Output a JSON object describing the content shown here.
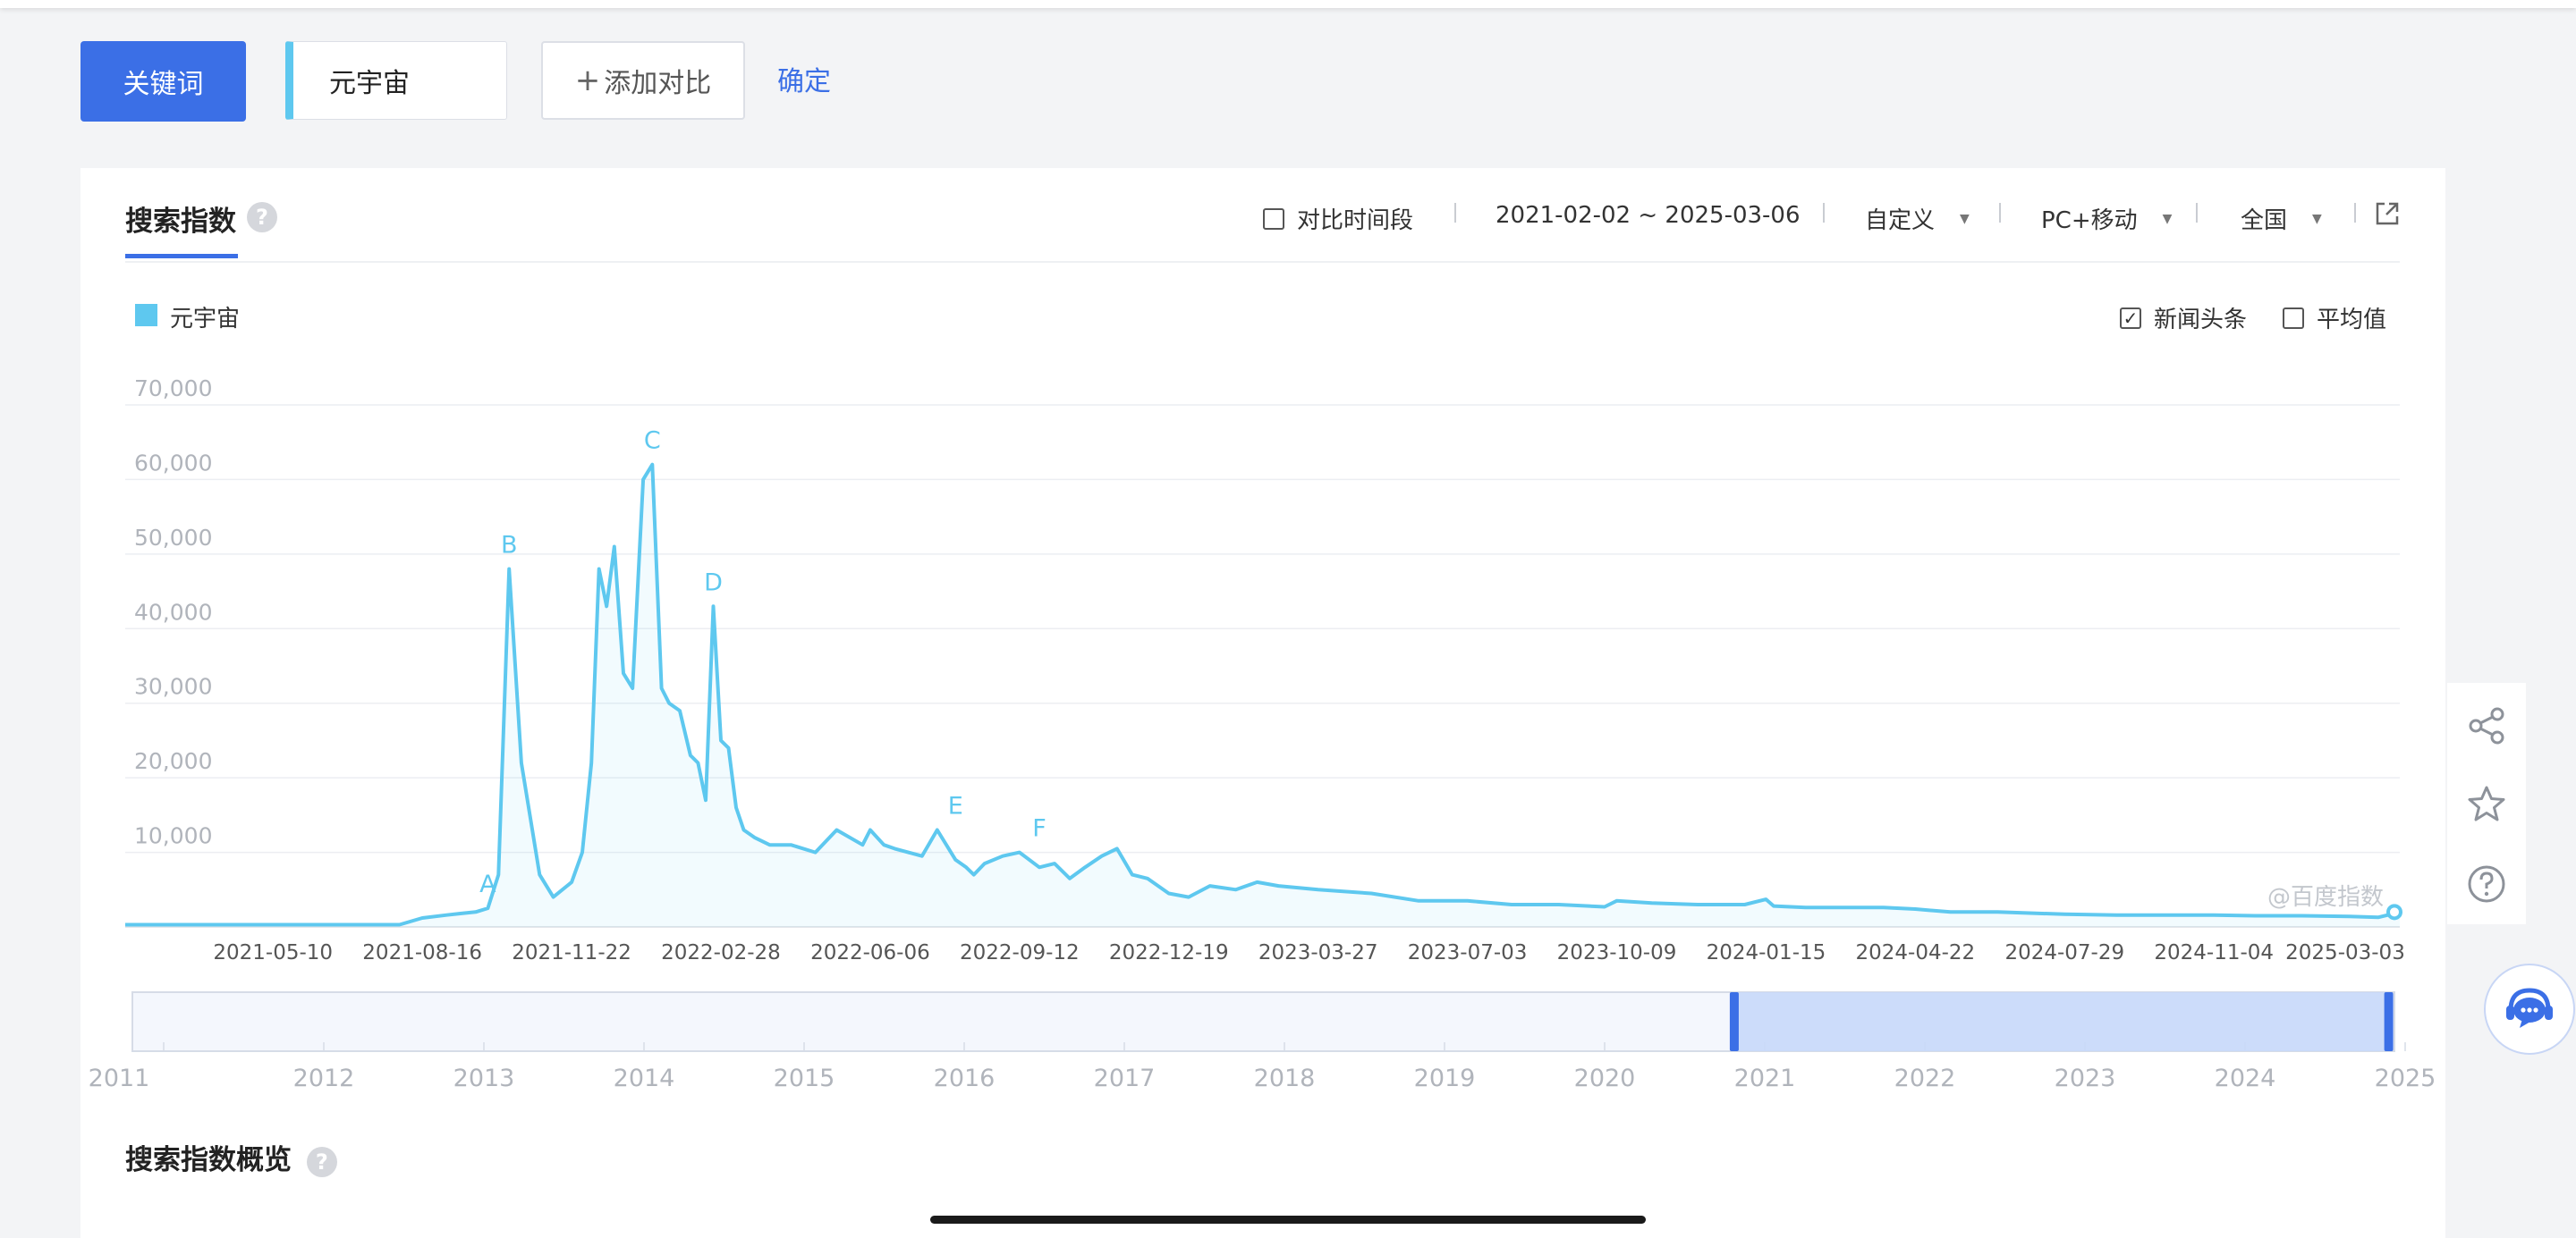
{
  "toolbar": {
    "keyword_button": "关键词",
    "keyword_value": "元宇宙",
    "add_compare": "添加对比",
    "confirm": "确定"
  },
  "card": {
    "tab_title": "搜索指数",
    "help_glyph": "?",
    "compare_period": "对比时间段",
    "date_range": "2021-02-02 ~ 2025-03-06",
    "custom": "自定义",
    "device": "PC+移动",
    "region": "全国",
    "legend": "元宇宙",
    "news_headlines": {
      "label": "新闻头条",
      "checked": true
    },
    "average": {
      "label": "平均值",
      "checked": false
    },
    "watermark": "@百度指数"
  },
  "overview": {
    "title": "搜索指数概览"
  },
  "colors": {
    "accent": "#3b6fe6",
    "series": "#5ec8ef",
    "brush": "#c8d8fa"
  },
  "icons": {
    "external": "external-link-icon",
    "share": "share-icon",
    "star": "star-icon",
    "help": "question-circle-icon",
    "chat": "customer-service-icon"
  },
  "chart_data": {
    "type": "area",
    "series": [
      {
        "name": "元宇宙",
        "x": [
          "2021-02-02",
          "2021-03-15",
          "2021-05-10",
          "2021-06-20",
          "2021-07-20",
          "2021-08-01",
          "2021-08-16",
          "2021-09-01",
          "2021-09-10",
          "2021-09-20",
          "2021-09-28",
          "2021-10-05",
          "2021-10-12",
          "2021-10-20",
          "2021-11-01",
          "2021-11-10",
          "2021-11-22",
          "2021-11-29",
          "2021-12-05",
          "2021-12-10",
          "2021-12-15",
          "2021-12-20",
          "2021-12-26",
          "2022-01-01",
          "2022-01-08",
          "2022-01-14",
          "2022-01-20",
          "2022-01-25",
          "2022-02-01",
          "2022-02-08",
          "2022-02-13",
          "2022-02-18",
          "2022-02-23",
          "2022-02-28",
          "2022-03-05",
          "2022-03-10",
          "2022-03-15",
          "2022-03-22",
          "2022-04-01",
          "2022-04-15",
          "2022-05-01",
          "2022-05-15",
          "2022-06-01",
          "2022-06-06",
          "2022-06-15",
          "2022-06-22",
          "2022-07-01",
          "2022-07-10",
          "2022-07-20",
          "2022-08-01",
          "2022-08-08",
          "2022-08-13",
          "2022-08-20",
          "2022-09-01",
          "2022-09-12",
          "2022-09-25",
          "2022-10-05",
          "2022-10-15",
          "2022-10-25",
          "2022-11-05",
          "2022-11-15",
          "2022-11-25",
          "2022-12-05",
          "2022-12-19",
          "2023-01-01",
          "2023-01-15",
          "2023-02-01",
          "2023-02-15",
          "2023-03-01",
          "2023-03-27",
          "2023-05-01",
          "2023-06-01",
          "2023-06-20",
          "2023-07-03",
          "2023-08-01",
          "2023-09-01",
          "2023-10-01",
          "2023-10-09",
          "2023-11-01",
          "2023-12-01",
          "2024-01-01",
          "2024-01-15",
          "2024-01-20",
          "2024-02-10",
          "2024-03-01",
          "2024-04-01",
          "2024-04-22",
          "2024-05-15",
          "2024-06-15",
          "2024-07-29",
          "2024-09-01",
          "2024-10-01",
          "2024-11-04",
          "2024-12-01",
          "2025-01-01",
          "2025-02-01",
          "2025-02-20",
          "2025-03-06"
        ],
        "values": [
          300,
          300,
          300,
          300,
          300,
          300,
          1200,
          1600,
          1800,
          2000,
          2500,
          7000,
          48000,
          22000,
          7000,
          4000,
          6000,
          10000,
          22000,
          48000,
          43000,
          51000,
          34000,
          32000,
          60000,
          62000,
          32000,
          30000,
          29000,
          23000,
          22000,
          17000,
          43000,
          25000,
          24000,
          16000,
          13000,
          12000,
          11000,
          11000,
          10000,
          13000,
          11000,
          13000,
          11000,
          10500,
          10000,
          9500,
          13000,
          9000,
          8000,
          7000,
          8500,
          9500,
          10000,
          8000,
          8500,
          6500,
          8000,
          9500,
          10500,
          7000,
          6500,
          4500,
          4000,
          5500,
          5000,
          6000,
          5500,
          5000,
          4500,
          3500,
          3500,
          3500,
          3000,
          3000,
          2700,
          3500,
          3200,
          3000,
          3000,
          3700,
          2800,
          2600,
          2600,
          2600,
          2400,
          2000,
          2000,
          1700,
          1600,
          1600,
          1600,
          1500,
          1500,
          1400,
          1300,
          2000
        ]
      }
    ],
    "x_ticks": [
      "2021-05-10",
      "2021-08-16",
      "2021-11-22",
      "2022-02-28",
      "2022-06-06",
      "2022-09-12",
      "2022-12-19",
      "2023-03-27",
      "2023-07-03",
      "2023-10-09",
      "2024-01-15",
      "2024-04-22",
      "2024-07-29",
      "2024-11-04",
      "2025-03-03"
    ],
    "y_ticks": [
      "70,000",
      "60,000",
      "50,000",
      "40,000",
      "30,000",
      "20,000",
      "10,000"
    ],
    "ylim": [
      0,
      70000
    ],
    "annotations": [
      {
        "label": "A",
        "x": "2021-09-28",
        "y": 2500
      },
      {
        "label": "B",
        "x": "2021-10-12",
        "y": 48000
      },
      {
        "label": "C",
        "x": "2022-01-14",
        "y": 62000
      },
      {
        "label": "D",
        "x": "2022-02-23",
        "y": 43000
      },
      {
        "label": "E",
        "x": "2022-08-01",
        "y": 13000
      },
      {
        "label": "F",
        "x": "2022-09-25",
        "y": 10000
      }
    ],
    "range_years": [
      "2011",
      "2012",
      "2013",
      "2014",
      "2015",
      "2016",
      "2017",
      "2018",
      "2019",
      "2020",
      "2021",
      "2022",
      "2023",
      "2024",
      "2025"
    ],
    "range_selection": [
      "2021-02-02",
      "2025-03-06"
    ],
    "grid": true,
    "legend_position": "top-left"
  }
}
